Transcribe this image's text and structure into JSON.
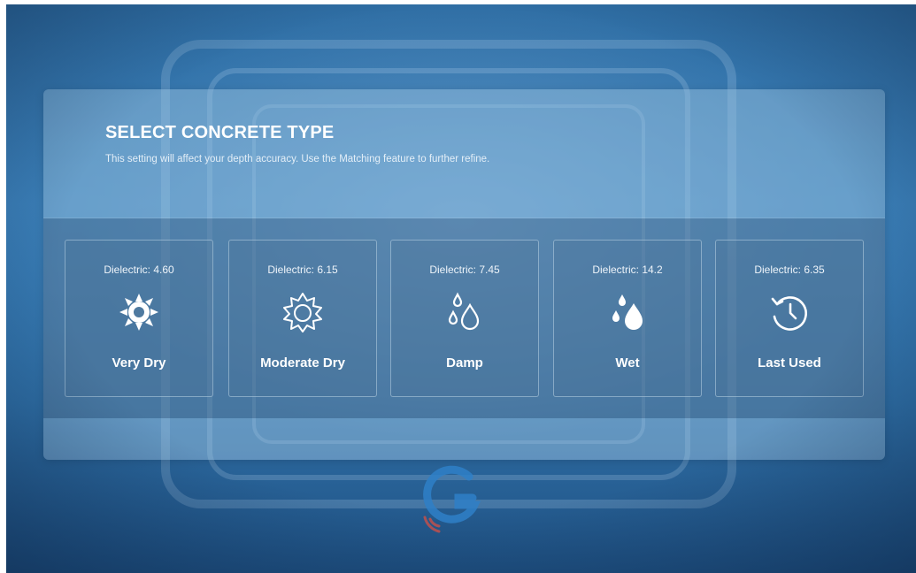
{
  "header": {
    "title": "SELECT CONCRETE TYPE",
    "subtitle": "This setting will affect your depth accuracy. Use the Matching feature to further refine."
  },
  "cards": [
    {
      "dielectric": "Dielectric: 4.60",
      "label": "Very Dry",
      "icon": "sun-solid-icon"
    },
    {
      "dielectric": "Dielectric: 6.15",
      "label": "Moderate Dry",
      "icon": "sun-outline-icon"
    },
    {
      "dielectric": "Dielectric: 7.45",
      "label": "Damp",
      "icon": "droplets-outline-icon"
    },
    {
      "dielectric": "Dielectric: 14.2",
      "label": "Wet",
      "icon": "droplets-solid-icon"
    },
    {
      "dielectric": "Dielectric: 6.35",
      "label": "Last Used",
      "icon": "history-icon"
    }
  ],
  "colors": {
    "background": "#2f6ea4",
    "text": "#ffffff",
    "logo_blue": "#2f80c8",
    "logo_red": "#c0504d"
  }
}
